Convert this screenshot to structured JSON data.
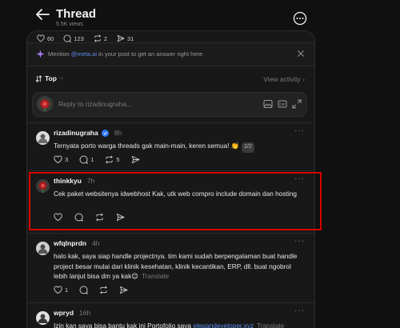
{
  "header": {
    "title": "Thread",
    "views": "5.5K views"
  },
  "stats": {
    "likes": "60",
    "comments": "123",
    "reposts": "2",
    "shares": "31"
  },
  "mention": {
    "prefix": "Mention ",
    "handle": "@meta.ai",
    "suffix": " in your post to get an answer right here"
  },
  "sort": {
    "label": "Top",
    "view_activity": "View activity ›"
  },
  "reply": {
    "placeholder": "Reply to rizadinugraha..."
  },
  "posts": [
    {
      "name": "rizadinugraha",
      "time": "8h",
      "verified": true,
      "text": "Ternyata porto warga threads gak main-main, keren semua! 👏",
      "pager": "2/2",
      "likes": "3",
      "comments": "1",
      "reposts": "5",
      "avatar_color": "#e8e8e8"
    },
    {
      "name": "thinkkyu",
      "time": "7h",
      "text": "Cek paket websitenya idwebhost Kak, utk web compro include domain dan hosting",
      "likes": "",
      "comments": "",
      "reposts": "",
      "avatar_color": "#8b1a1a"
    },
    {
      "name": "wfqlnprdn",
      "time": "4h",
      "text": "halo kak, saya siap handle projectnya. tim kami sudah berpengalaman buat handle project besar mulai dari klinik kesehatan, klinik kecantikan, ERP, dll. buat ngobrol lebih lanjut bisa dm ya kak😊",
      "translate": "Translate",
      "likes": "1",
      "comments": "",
      "reposts": "",
      "avatar_color": "#c9c9c9"
    },
    {
      "name": "wpryd",
      "time": "16h",
      "text": "Izin kan saya bisa bantu kak ini Portofolio saya ",
      "link": "elegandeveloper.xyz",
      "translate": "Translate",
      "avatar_color": "#e0e0e0"
    }
  ],
  "colors": {
    "accent_link": "#5b8def",
    "highlight": "#d40000",
    "background": "#101010",
    "panel": "#181818"
  }
}
